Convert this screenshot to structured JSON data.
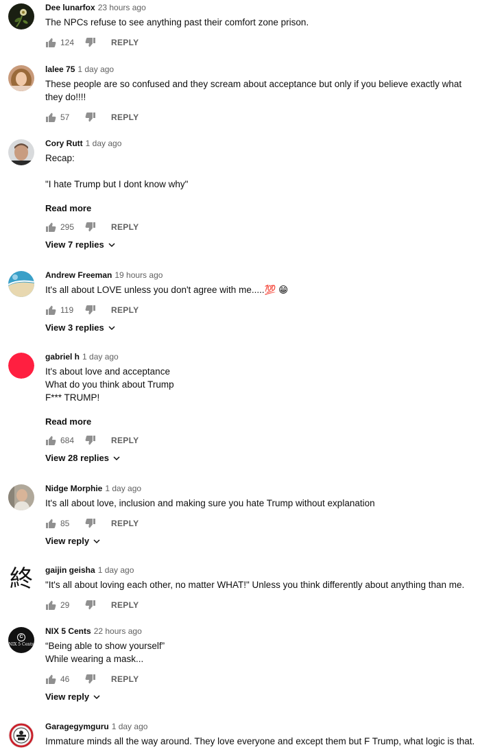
{
  "comments": [
    {
      "author": "Dee lunarfox",
      "time": "23 hours ago",
      "lines": [
        "The NPCs refuse to see anything past their comfort zone prison."
      ],
      "likes": "124",
      "reply_label": "REPLY"
    },
    {
      "author": "lalee 75",
      "time": "1 day ago",
      "lines": [
        "These people are so confused and they scream about acceptance but only if you believe exactly what",
        "they do!!!!"
      ],
      "likes": "57",
      "reply_label": "REPLY"
    },
    {
      "author": "Cory Rutt",
      "time": "1 day ago",
      "lines": [
        "Recap:",
        "",
        "\"I hate Trump but I dont know why\""
      ],
      "read_more": "Read more",
      "likes": "295",
      "reply_label": "REPLY",
      "view_replies": "View 7 replies"
    },
    {
      "author": "Andrew Freeman",
      "time": "19 hours ago",
      "lines": [
        "It's all about LOVE unless you don't agree with me.....💯 😁"
      ],
      "likes": "119",
      "reply_label": "REPLY",
      "view_replies": "View 3 replies"
    },
    {
      "author": "gabriel h",
      "time": "1 day ago",
      "lines": [
        "It's about love and acceptance",
        "What do you think about Trump",
        "F*** TRUMP!"
      ],
      "read_more": "Read more",
      "likes": "684",
      "reply_label": "REPLY",
      "view_replies": "View 28 replies"
    },
    {
      "author": "Nidge Morphie",
      "time": "1 day ago",
      "lines": [
        "It's all about love, inclusion and making sure you hate Trump without explanation"
      ],
      "likes": "85",
      "reply_label": "REPLY",
      "view_replies": "View reply"
    },
    {
      "author": "gaijin geisha",
      "time": "1 day ago",
      "avatar_glyph": "終",
      "lines": [
        "\"It's all about loving each other, no matter WHAT!\" Unless you think differently about anything than me."
      ],
      "likes": "29",
      "reply_label": "REPLY"
    },
    {
      "author": "NIX 5 Cents",
      "time": "22 hours ago",
      "avatar_text": "NIX 5 Cents",
      "lines": [
        "“Being able to show yourself”",
        "While wearing a mask..."
      ],
      "likes": "46",
      "reply_label": "REPLY",
      "view_replies": "View reply"
    },
    {
      "author": "Garagegymguru",
      "time": "1 day ago",
      "lines": [
        "Immature minds all the way around. They love everyone and except them but F Trump, what logic is that."
      ]
    }
  ],
  "icons": {
    "like": "thumbs-up-icon",
    "dislike": "thumbs-down-icon",
    "expand": "chevron-down-icon"
  },
  "colors": {
    "text": "#0f0f0f",
    "secondary": "#606060",
    "icon": "#909090",
    "gabriel_avatar": "#ff1f40"
  }
}
